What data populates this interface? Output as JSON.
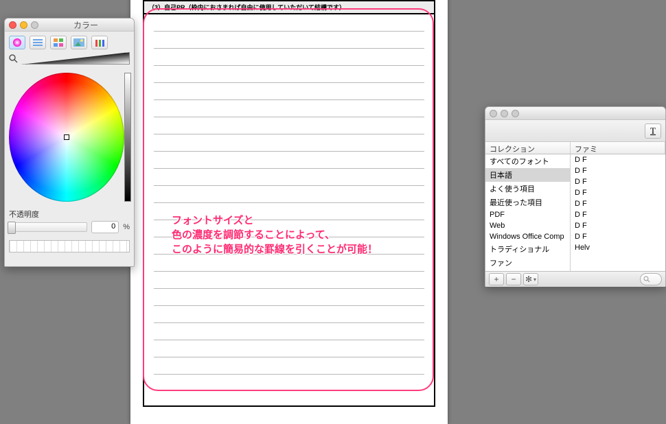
{
  "document": {
    "section_header": "（3）自己PR（枠内におさまれば自由に使用していただいて結構です）",
    "callout_line1": "フォントサイズと",
    "callout_line2": "色の濃度を調節することによって、",
    "callout_line3": "このように簡易的な罫線を引くことが可能！",
    "rule_count": 21
  },
  "color_panel": {
    "title": "カラー",
    "traffic": {
      "close": "#ff5f57",
      "min": "#febc2e",
      "zoom": "#cdcdcd"
    },
    "opacity_label": "不透明度",
    "opacity_value": "0",
    "opacity_unit": "%",
    "mode_tab_names": [
      "wheel",
      "sliders",
      "palettes",
      "image",
      "crayons"
    ]
  },
  "font_panel": {
    "traffic": {
      "close": "#cdcdcd",
      "min": "#cdcdcd",
      "zoom": "#cdcdcd"
    },
    "toolbar_button": "T",
    "columns": {
      "collection": "コレクション",
      "family": "ファミ"
    },
    "collections": [
      {
        "label": "すべてのフォント",
        "family": "D F",
        "selected": false
      },
      {
        "label": "日本語",
        "family": "D F",
        "selected": true
      },
      {
        "label": "よく使う項目",
        "family": "D F",
        "selected": false
      },
      {
        "label": "最近使った項目",
        "family": "D F",
        "selected": false
      },
      {
        "label": "PDF",
        "family": "D F",
        "selected": false
      },
      {
        "label": "Web",
        "family": "D F",
        "selected": false
      },
      {
        "label": "Windows Office Comp",
        "family": "D F",
        "selected": false
      },
      {
        "label": "トラディショナル",
        "family": "D F",
        "selected": false
      },
      {
        "label": "ファン",
        "family": "Helv",
        "selected": false
      }
    ],
    "bottom_buttons": {
      "add": "+",
      "remove": "−",
      "gear": "✻",
      "search": ""
    }
  }
}
